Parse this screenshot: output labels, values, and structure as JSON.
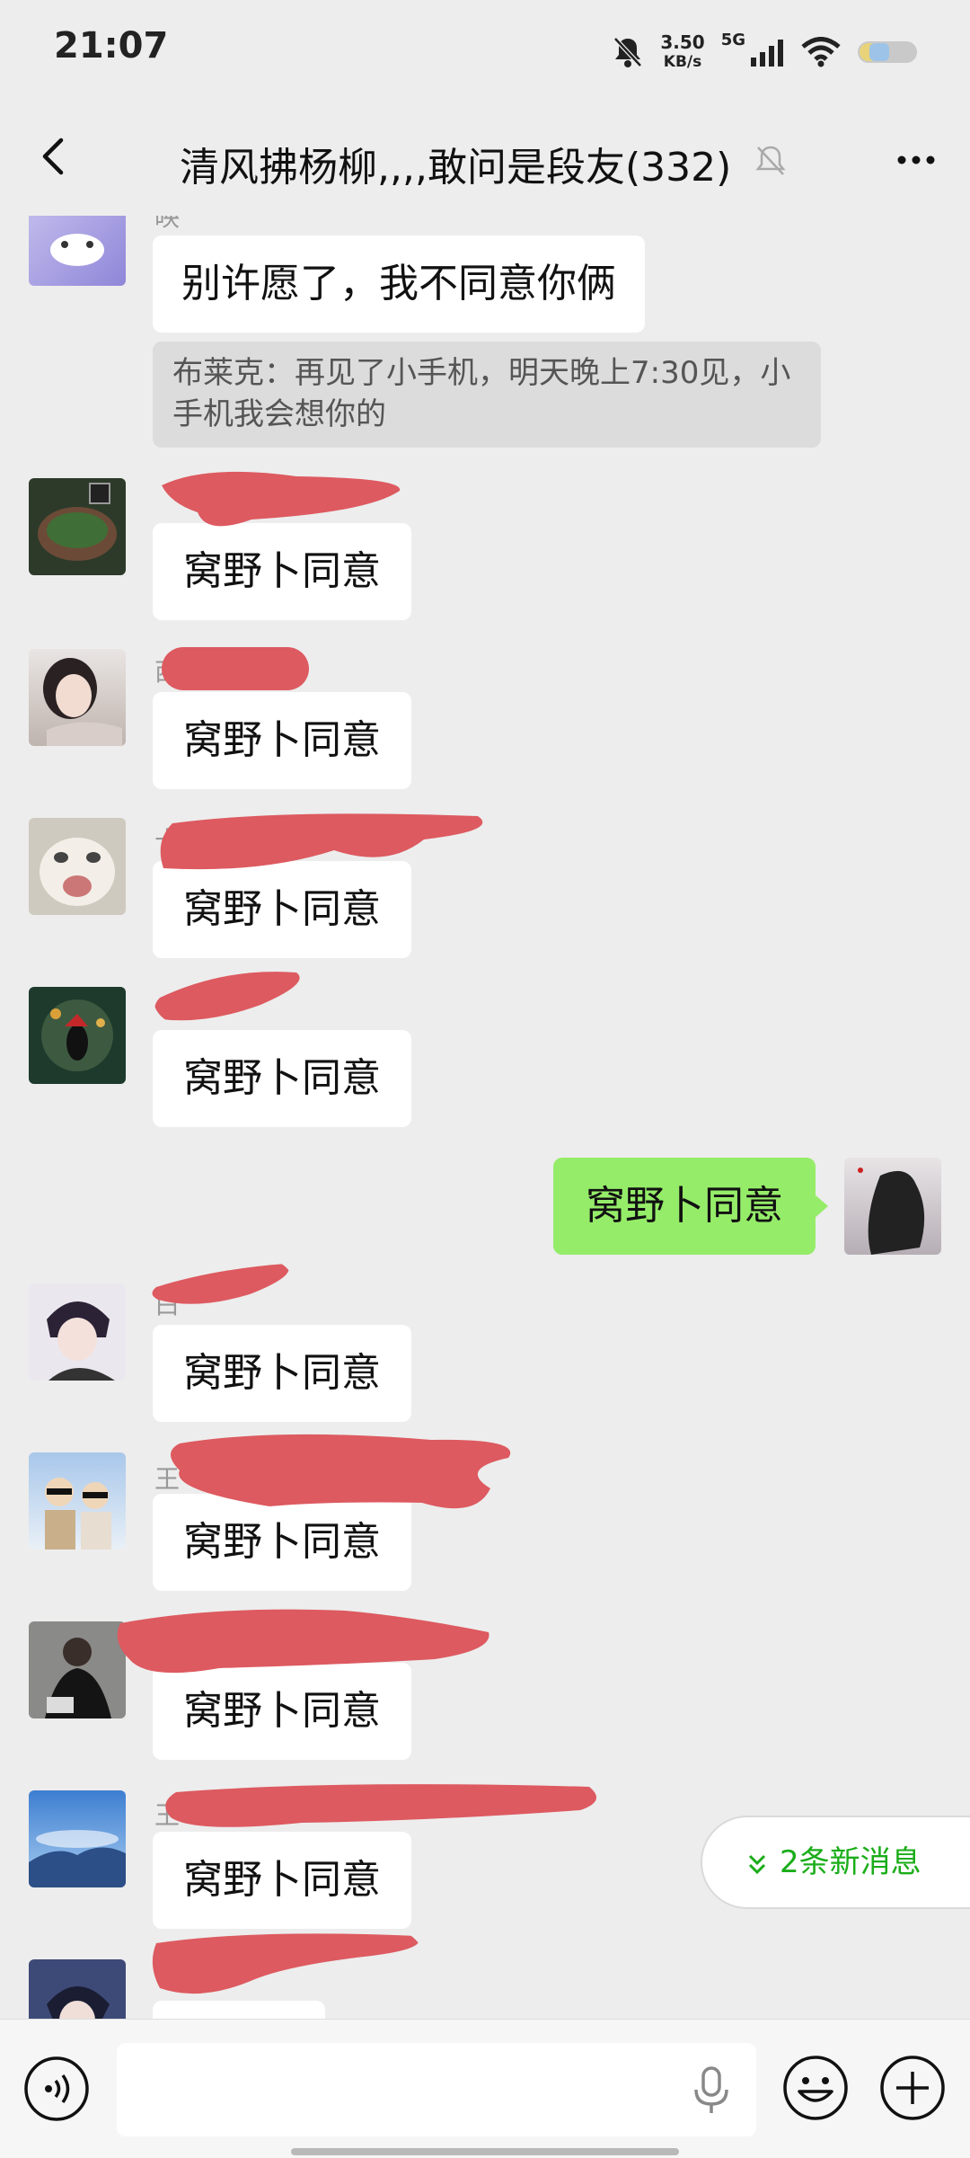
{
  "status_bar": {
    "time": "21:07",
    "speed_value": "3.50",
    "speed_unit": "KB/s",
    "network": "5G"
  },
  "header": {
    "title": "清风拂杨柳,,,,敢问是段友(332)"
  },
  "messages": {
    "first_sender": "映",
    "first_text": "别许愿了，我不同意你俩",
    "quote_text": "布莱克：再见了小手机，明天晚上7:30见，小手机我会想你的",
    "reply_text": "窝野卜同意",
    "my_text": "窝野卜同意",
    "visible_sender_chars": [
      "西",
      "十",
      "白",
      "王",
      "王",
      "王"
    ]
  },
  "new_messages_label": "2条新消息",
  "colors": {
    "background": "#ededed",
    "my_bubble": "#95ec69",
    "redaction": "#dd5a60",
    "accent_green": "#1aad19"
  },
  "icons": [
    "back-arrow-icon",
    "mute-bell-icon",
    "more-dots-icon",
    "double-chevron-down-icon",
    "voice-toggle-icon",
    "microphone-icon",
    "emoji-icon",
    "plus-icon"
  ]
}
